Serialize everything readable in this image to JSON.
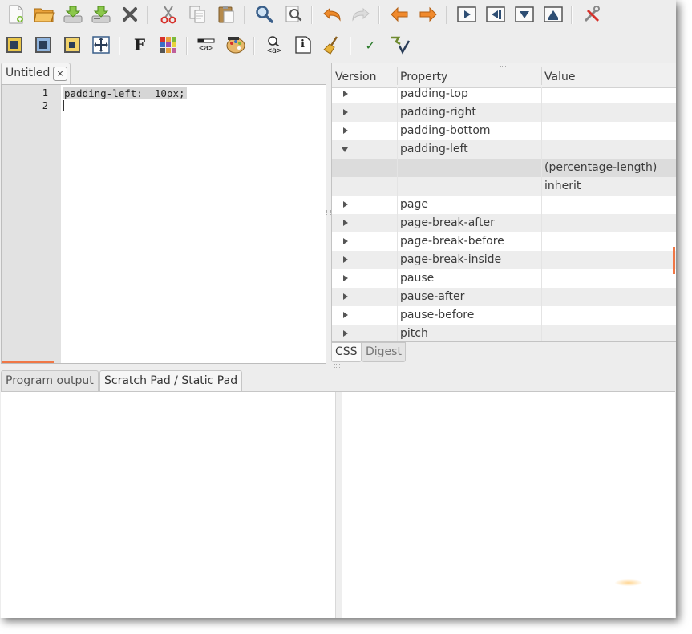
{
  "toolbar1": {
    "icons": [
      "new-file-icon",
      "open-folder-icon",
      "save-download-icon",
      "save-as-icon",
      "close-x-icon",
      "cut-scissors-icon",
      "copy-icon",
      "paste-icon",
      "find-magnifier-icon",
      "find-replace-icon",
      "undo-icon",
      "redo-icon",
      "back-arrow-icon",
      "forward-arrow-icon",
      "play-icon",
      "step-back-icon",
      "step-down-icon",
      "step-up-icon",
      "tools-icon"
    ]
  },
  "toolbar2": {
    "icons": [
      "box-yellow-icon",
      "box-blue-icon",
      "box-yellow-small-icon",
      "move-cross-icon",
      "font-bold-icon",
      "color-grid-icon",
      "anchor-tag-icon",
      "palette-icon",
      "find-anchor-icon",
      "info-icon",
      "broom-icon",
      "check-icon",
      "validate-icon"
    ],
    "font_label": "F",
    "anchor_label": "<a>",
    "find_anchor_label": "<a>",
    "info_label": "i",
    "check_label": "✓"
  },
  "editor": {
    "tab_title": "Untitled",
    "tab_close": "×",
    "line_numbers": [
      "1",
      "2"
    ],
    "code_line_1": "padding-left:  10px;"
  },
  "tree": {
    "columns": [
      "Version",
      "Property",
      "Value"
    ],
    "rows": [
      {
        "property": "padding-top",
        "value": "",
        "expander": "collapsed"
      },
      {
        "property": "padding-right",
        "value": "",
        "expander": "collapsed"
      },
      {
        "property": "padding-bottom",
        "value": "",
        "expander": "collapsed"
      },
      {
        "property": "padding-left",
        "value": "",
        "expander": "expanded"
      },
      {
        "property": "",
        "value": "(percentage-length)",
        "expander": "none"
      },
      {
        "property": "",
        "value": "inherit",
        "expander": "none"
      },
      {
        "property": "page",
        "value": "",
        "expander": "collapsed"
      },
      {
        "property": "page-break-after",
        "value": "",
        "expander": "collapsed"
      },
      {
        "property": "page-break-before",
        "value": "",
        "expander": "collapsed"
      },
      {
        "property": "page-break-inside",
        "value": "",
        "expander": "collapsed"
      },
      {
        "property": "pause",
        "value": "",
        "expander": "collapsed"
      },
      {
        "property": "pause-after",
        "value": "",
        "expander": "collapsed"
      },
      {
        "property": "pause-before",
        "value": "",
        "expander": "collapsed"
      },
      {
        "property": "pitch",
        "value": "",
        "expander": "collapsed"
      }
    ]
  },
  "bottom_tabs_right": {
    "css": "CSS",
    "digest": "Digest"
  },
  "bottom_tabs_left": {
    "program_output": "Program output",
    "scratch_pad": "Scratch Pad / Static Pad"
  },
  "colors": {
    "accent": "#f07746",
    "selection": "#d6d6d6"
  }
}
